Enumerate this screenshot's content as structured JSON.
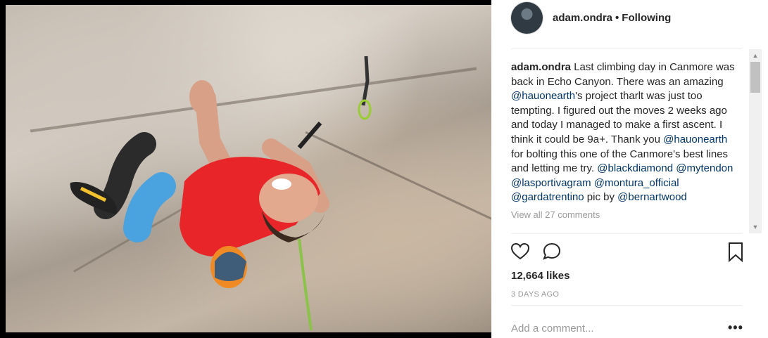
{
  "post": {
    "username": "adam.ondra",
    "separator": "•",
    "follow_status": "Following"
  },
  "caption": {
    "author": "adam.ondra",
    "parts": [
      " Last climbing day in Canmore was back in Echo Canyon. There was an amazing ",
      "@hauonearth",
      "'s project tharlt was just too tempting. I figured out the moves 2 weeks ago and today I managed to make a first ascent. I think it could be 9a+. Thank you ",
      "@hauonearth",
      " for bolting this one of the Canmore's best lines and letting me try. ",
      "@blackdiamond",
      " ",
      "@mytendon",
      " ",
      "@lasportivagram",
      " ",
      "@montura_official",
      " ",
      "@gardatrentino",
      " pic by ",
      "@bernartwood"
    ],
    "view_comments": "View all 27 comments"
  },
  "stats": {
    "likes": "12,664 likes",
    "time": "3 DAYS AGO"
  },
  "comment_box": {
    "placeholder": "Add a comment...",
    "more_label": "•••"
  },
  "icons": {
    "like": "heart-icon",
    "comment": "comment-bubble-icon",
    "save": "bookmark-icon"
  },
  "colors": {
    "text": "#262626",
    "mention": "#003569",
    "muted": "#999999",
    "climber_shirt": "#e8262a",
    "rope": "#8bc34a"
  }
}
